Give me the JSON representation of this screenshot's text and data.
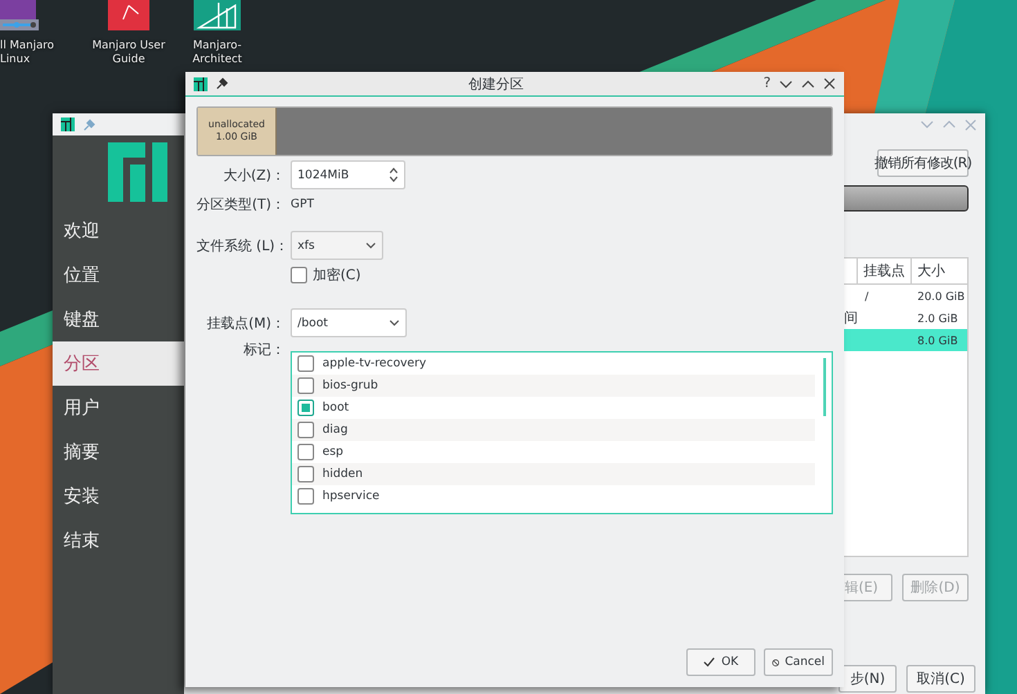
{
  "desktop_icons": [
    {
      "label": "ll Manjaro Linux",
      "kind": "installer"
    },
    {
      "label": "Manjaro User Guide",
      "kind": "guide"
    },
    {
      "label": "Manjaro-Architect",
      "kind": "architect"
    }
  ],
  "installer": {
    "sidebar": [
      {
        "label": "欢迎",
        "selected": false
      },
      {
        "label": "位置",
        "selected": false
      },
      {
        "label": "键盘",
        "selected": false
      },
      {
        "label": "分区",
        "selected": true
      },
      {
        "label": "用户",
        "selected": false
      },
      {
        "label": "摘要",
        "selected": false
      },
      {
        "label": "安装",
        "selected": false
      },
      {
        "label": "结束",
        "selected": false
      }
    ],
    "revert_button": "撤销所有修改(R)",
    "table": {
      "columns": [
        "挂载点",
        "大小"
      ],
      "rows": [
        {
          "mount": "/",
          "size": "20.0 GiB",
          "selected": false
        },
        {
          "column_1": "间",
          "size": "2.0 GiB",
          "selected": false
        },
        {
          "size": "8.0 GiB",
          "selected": true
        }
      ]
    },
    "edit_button": "辑(E)",
    "delete_button": "删除(D)",
    "next_button": "步(N)",
    "cancel_button": "取消(C)"
  },
  "dialog": {
    "title": "创建分区",
    "help": "?",
    "partition": {
      "label": "unallocated",
      "size": "1.00 GiB"
    },
    "size": {
      "label": "大小(Z)：",
      "value": "1024MiB"
    },
    "partition_type": {
      "label": "分区类型(T)：",
      "value": "GPT"
    },
    "filesystem": {
      "label": "文件系统 (L)：",
      "value": "xfs"
    },
    "encrypt": {
      "label": "加密(C)",
      "checked": false
    },
    "mount_point": {
      "label": "挂载点(M)：",
      "value": "/boot"
    },
    "flags": {
      "label": "标记：",
      "items": [
        {
          "label": "apple-tv-recovery",
          "checked": false
        },
        {
          "label": "bios-grub",
          "checked": false
        },
        {
          "label": "boot",
          "checked": true
        },
        {
          "label": "diag",
          "checked": false
        },
        {
          "label": "esp",
          "checked": false
        },
        {
          "label": "hidden",
          "checked": false
        },
        {
          "label": "hpservice",
          "checked": false
        }
      ]
    },
    "buttons": [
      {
        "label": "OK",
        "kind": "ok"
      },
      {
        "label": "Cancel",
        "kind": "cancel"
      }
    ]
  }
}
